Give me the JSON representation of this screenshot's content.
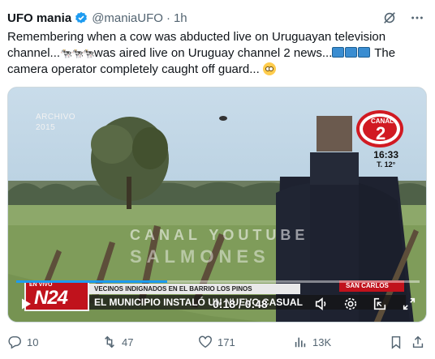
{
  "author": {
    "name": "UFO mania",
    "handle": "@maniaUFO",
    "separator": "·",
    "time": "1h"
  },
  "tweet": {
    "line1": "Remembering when a cow was abducted live on Uruguayan television",
    "line2_a": "channel...",
    "line2_cows": "🐄🐄🐄",
    "line2_b": "was aired live on Uruguay channel 2 news...",
    "line2_c": " The",
    "line3": "camera operator  completely caught off guard... "
  },
  "video": {
    "watermark_line1": "ARCHIVO",
    "watermark_line2": "2015",
    "channel_logo": "CANAL 2",
    "channel_number": "2",
    "clock_time": "16:33",
    "clock_temp": "T. 12°",
    "faded_text1": "CANAL YOUTUBE",
    "faded_text2": "SALMONES",
    "en_vivo": "EN VIVO",
    "n24": "N24",
    "ticker_top": "VECINOS INDIGNADOS EN EL BARRIO LOS PINOS",
    "ticker_location": "SAN CARLOS",
    "ticker_main": "EL MUNICIPIO INSTALÓ UN NUEVO CASUAL",
    "timecode": "0:18 / 0:48",
    "progress": 0.375
  },
  "actions": {
    "replies": "10",
    "retweets": "47",
    "likes": "171",
    "views": "13K"
  },
  "colors": {
    "accent": "#1d9bf0",
    "muted": "#536471",
    "text": "#0f1419"
  }
}
